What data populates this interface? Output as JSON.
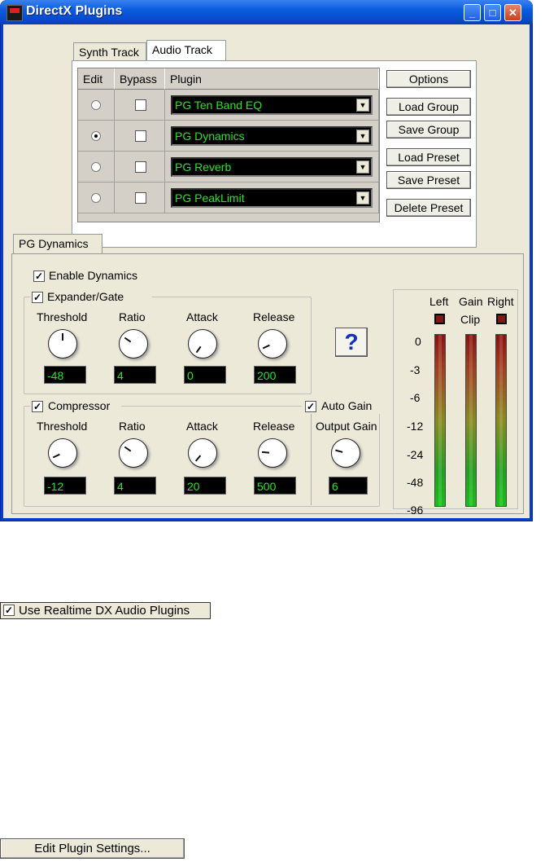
{
  "window": {
    "title": "DirectX Plugins",
    "minimize": "_",
    "maximize": "□",
    "close": "✕"
  },
  "tabs": [
    {
      "label": "Synth Track"
    },
    {
      "label": "Audio Track"
    }
  ],
  "grid": {
    "headers": {
      "edit": "Edit",
      "bypass": "Bypass",
      "plugin": "Plugin"
    },
    "rows": [
      {
        "plugin": "PG Ten Band EQ",
        "edit_selected": false
      },
      {
        "plugin": "PG Dynamics",
        "edit_selected": true
      },
      {
        "plugin": "PG Reverb",
        "edit_selected": false
      },
      {
        "plugin": "PG PeakLimit",
        "edit_selected": false
      }
    ]
  },
  "buttons": {
    "options": "Options",
    "load_group": "Load Group",
    "save_group": "Save Group",
    "load_preset": "Load Preset",
    "save_preset": "Save Preset",
    "delete_preset": "Delete Preset"
  },
  "dynamics": {
    "tab_label": "PG Dynamics",
    "enable": "Enable Dynamics",
    "expander": {
      "title": "Expander/Gate",
      "controls": [
        {
          "label": "Threshold",
          "value": "-48"
        },
        {
          "label": "Ratio",
          "value": "4"
        },
        {
          "label": "Attack",
          "value": "0"
        },
        {
          "label": "Release",
          "value": "200"
        }
      ]
    },
    "compressor": {
      "title": "Compressor",
      "controls": [
        {
          "label": "Threshold",
          "value": "-12"
        },
        {
          "label": "Ratio",
          "value": "4"
        },
        {
          "label": "Attack",
          "value": "20"
        },
        {
          "label": "Release",
          "value": "500"
        }
      ]
    },
    "auto_gain": "Auto Gain",
    "output_gain": {
      "label": "Output Gain",
      "value": "6"
    },
    "help": "?",
    "meters": {
      "left": "Left",
      "gain": "Gain",
      "right": "Right",
      "clip": "Clip",
      "scale": [
        "0",
        "-3",
        "-6",
        "-12",
        "-24",
        "-48",
        "-96"
      ]
    }
  },
  "realtime_checkbox": "Use Realtime DX Audio Plugins",
  "edit_settings_button": "Edit Plugin Settings...",
  "check_mark": "✓"
}
